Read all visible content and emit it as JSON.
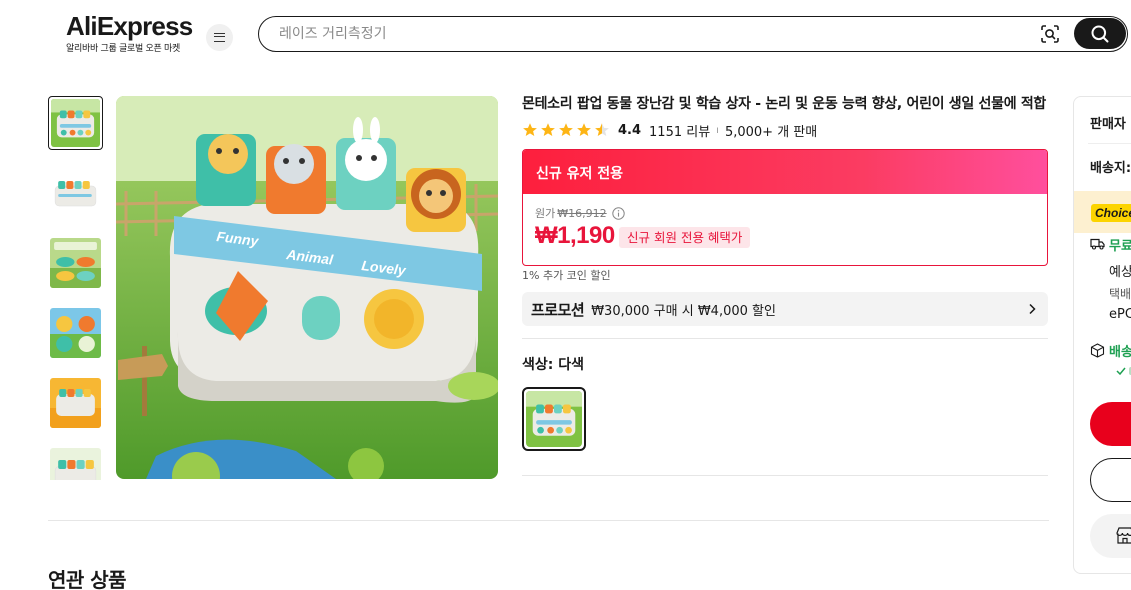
{
  "header": {
    "logo_text": "AliExpress",
    "logo_subtitle": "알리바바 그룹 글로벌 오픈 마켓",
    "search_placeholder": "레이즈 거리측정기"
  },
  "gallery": {
    "thumbnail_count": 6,
    "active_index": 0
  },
  "product": {
    "title": "몬테소리 팝업 동물 장난감 및 학습 상자 - 논리 및 운동 능력 향상, 어린이 생일 선물에 적합",
    "rating": "4.4",
    "stars_filled": 4.5,
    "reviews": "1151 리뷰",
    "separator": "ı",
    "sold": "5,000+ 개 판매"
  },
  "promo_card": {
    "header": "신규 유저 전용",
    "original_label": "원가",
    "original_price": "₩16,912",
    "price": "₩1,190",
    "badge": "신규 회원 전용 혜택가"
  },
  "coin_note": "1% 추가 코인 할인",
  "promotion": {
    "tag": "프로모션",
    "text": "₩30,000 구매 시 ₩4,000 할인"
  },
  "color": {
    "label": "색상: 다색"
  },
  "side_panel": {
    "seller_label": "판매자",
    "ship_to_label": "배송지:",
    "choice_badge": "Choice",
    "free_shipping": "무료",
    "eta": "예상",
    "carrier": "택배",
    "epc": "ePC",
    "delivery_label": "배송"
  },
  "related": {
    "title": "연관 상품"
  },
  "colors": {
    "brand_red": "#e8153b",
    "free_green": "#1ea052",
    "choice_yellow": "#fcd400"
  }
}
